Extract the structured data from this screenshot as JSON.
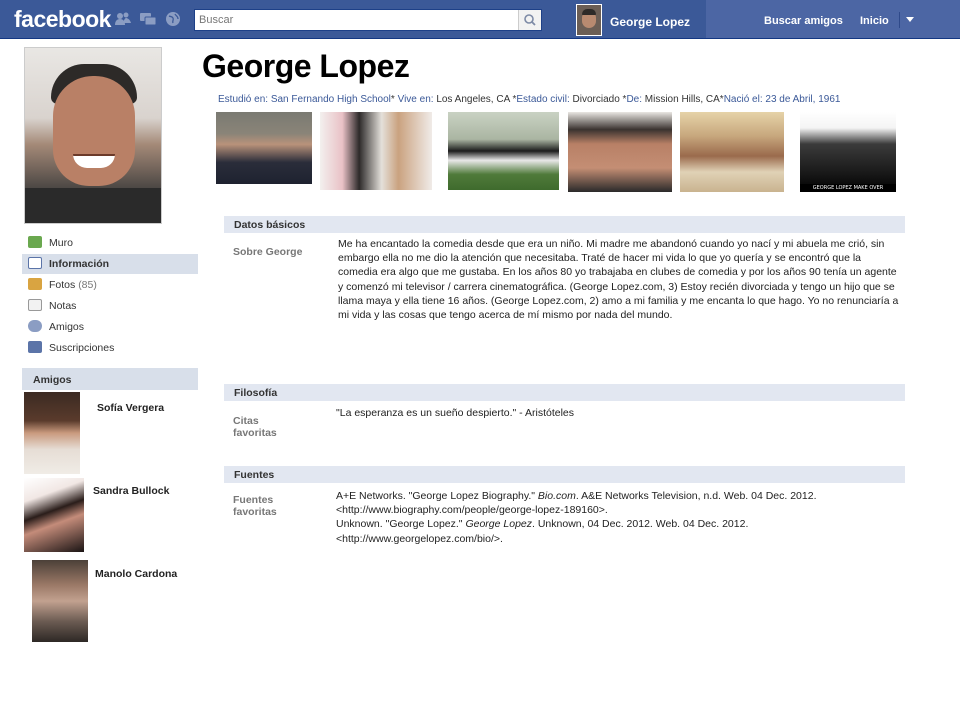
{
  "topbar": {
    "logo": "facebook",
    "search_placeholder": "Buscar",
    "user_name": "George Lopez",
    "find_friends": "Buscar amigos",
    "home": "Inicio"
  },
  "sidebar": {
    "items": [
      {
        "label": "Muro",
        "icon": "wall-icon"
      },
      {
        "label": "Información",
        "icon": "info-icon",
        "selected": true
      },
      {
        "label": "Fotos",
        "count": "(85)",
        "icon": "photos-icon"
      },
      {
        "label": "Notas",
        "icon": "notes-icon"
      },
      {
        "label": "Amigos",
        "icon": "friends-icon"
      },
      {
        "label": "Suscripciones",
        "icon": "subscriptions-icon"
      }
    ],
    "friends_title": "Amigos",
    "friends": [
      "Sofía Vergera",
      "Sandra Bullock",
      "Manolo Cardona"
    ]
  },
  "profile": {
    "name": "George Lopez",
    "info": {
      "studied_label": "Estudió en:",
      "studied": "San Fernando High School",
      "lives_label": "Vive en:",
      "lives": "Los Angeles, CA",
      "civil_label": "Estado civil:",
      "civil": "Divorciado",
      "from_label": "De:",
      "from": "Mission Hills, CA",
      "born_label": "Nació el:",
      "born": "23 de Abril, 1961"
    }
  },
  "sections": {
    "basic": {
      "title": "Datos básicos",
      "about_label": "Sobre George",
      "about_text": "Me ha encantado la comedia desde que era un niño. Mi madre me abandonó cuando yo nací y mi abuela me crió, sin embargo ella no me dio la atención que necesitaba. Traté de hacer mi vida lo que yo quería y se encontró que la comedia era algo que me gustaba. En los años 80 yo trabajaba en clubes de comedia y por los años 90 tenía un agente y comenzó mi televisor / carrera cinematográfica. (George Lopez.com, 3) Estoy recién divorciada y tengo un hijo que se llama maya y ella tiene 16 años. (George Lopez.com, 2) amo a mi familia y me encanta lo que hago. Yo no renunciaría a mi vida y las cosas que tengo acerca de mí mismo por nada del mundo."
    },
    "philosophy": {
      "title": "Filosofía",
      "quotes_label": "Citas favoritas",
      "quotes": "\"La esperanza es un sueño despierto.\" - Aristóteles"
    },
    "sources": {
      "title": "Fuentes",
      "label": "Fuentes favoritas",
      "s1_a": "A+E Networks. \"George Lopez Biography.\" ",
      "s1_italic": "Bio.com",
      "s1_b": ". A&E Networks Television, n.d. Web. 04 Dec. 2012. <http://www.biography.com/people/george-lopez-189160>.",
      "s2_a": "Unknown. \"George Lopez.\" ",
      "s2_italic": "George Lopez",
      "s2_b": ". Unknown, 04 Dec. 2012. Web. 04 Dec. 2012. <http://www.georgelopez.com/bio/>."
    }
  },
  "photo_caption": "GEORGE LOPEZ MAKE OVER",
  "colors": {
    "brand": "#3b5998",
    "section_bg": "#e2e7f1",
    "nav_sel": "#d8dfea"
  }
}
